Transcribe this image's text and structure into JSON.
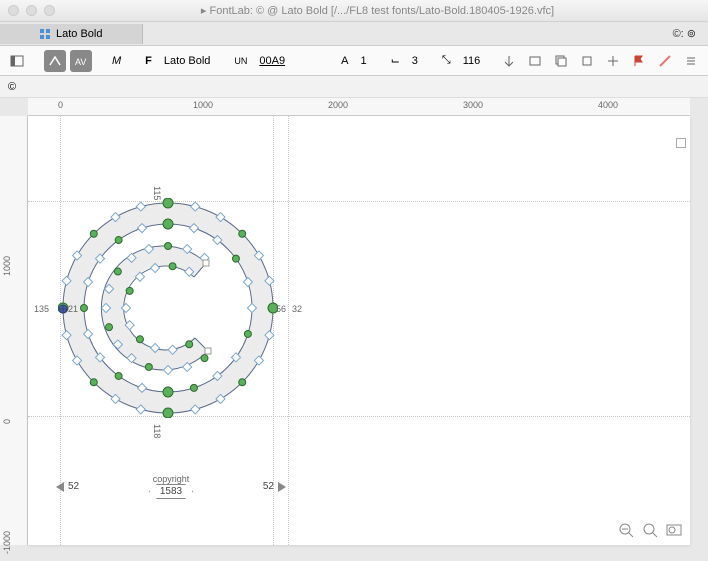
{
  "window": {
    "title": "▸ FontLab: © @ Lato Bold [/.../FL8 test fonts/Lato-Bold.180405-1926.vfc]"
  },
  "tab": {
    "name": "Lato Bold",
    "right_glyph": "©: ⊚"
  },
  "toolbar": {
    "m_label": "M",
    "f_label": "F",
    "font_name": "Lato Bold",
    "un_label": "UN",
    "unicode": "00A9",
    "a_label": "A",
    "a_val": "1",
    "layers_label": "⌙",
    "layers_val": "3",
    "anchors_label": "⤡",
    "anchors_val": "116"
  },
  "subbar": {
    "glyph": "©"
  },
  "ruler_h": [
    {
      "pos": 30,
      "label": "0"
    },
    {
      "pos": 165,
      "label": "1000"
    },
    {
      "pos": 300,
      "label": "2000"
    },
    {
      "pos": 435,
      "label": "3000"
    },
    {
      "pos": 570,
      "label": "4000"
    }
  ],
  "ruler_v": [
    {
      "pos": 308,
      "label": "0"
    },
    {
      "pos": 160,
      "label": "1000"
    },
    {
      "pos": 430,
      "label": "-1000"
    }
  ],
  "guides_v": [
    32,
    245,
    260
  ],
  "guides_h": [
    85,
    300
  ],
  "glyph": {
    "name": "copyright",
    "advance": "1583",
    "lsb": "52",
    "rsb": "52",
    "left_sb_small": "21",
    "top_metric": "115",
    "bottom_metric": "118",
    "left_metric": "135",
    "right_metric1": "56",
    "right_metric2": "32"
  }
}
